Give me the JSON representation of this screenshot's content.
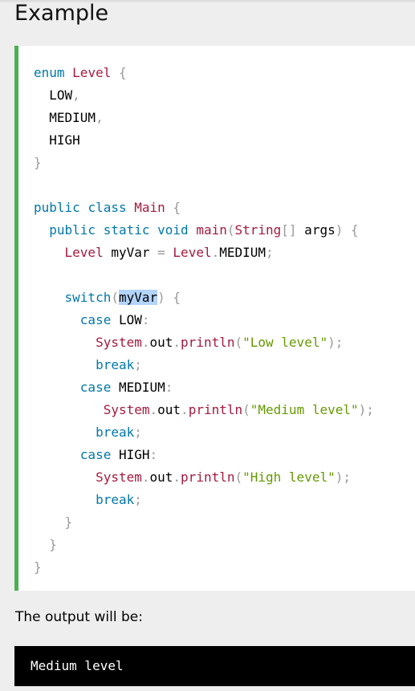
{
  "heading": "Example",
  "code_lines": [
    [
      [
        "kw",
        "enum"
      ],
      [
        "id",
        " "
      ],
      [
        "ty",
        "Level"
      ],
      [
        "id",
        " "
      ],
      [
        "sy",
        "{"
      ]
    ],
    [
      [
        "id",
        "  LOW"
      ],
      [
        "sy",
        ","
      ]
    ],
    [
      [
        "id",
        "  MEDIUM"
      ],
      [
        "sy",
        ","
      ]
    ],
    [
      [
        "id",
        "  HIGH"
      ]
    ],
    [
      [
        "sy",
        "}"
      ]
    ],
    [],
    [
      [
        "kw",
        "public"
      ],
      [
        "id",
        " "
      ],
      [
        "kw",
        "class"
      ],
      [
        "id",
        " "
      ],
      [
        "ty",
        "Main"
      ],
      [
        "id",
        " "
      ],
      [
        "sy",
        "{"
      ]
    ],
    [
      [
        "id",
        "  "
      ],
      [
        "kw",
        "public"
      ],
      [
        "id",
        " "
      ],
      [
        "kw",
        "static"
      ],
      [
        "id",
        " "
      ],
      [
        "kw",
        "void"
      ],
      [
        "id",
        " "
      ],
      [
        "ty",
        "main"
      ],
      [
        "sy",
        "("
      ],
      [
        "ty",
        "String"
      ],
      [
        "sy",
        "[]"
      ],
      [
        "id",
        " args"
      ],
      [
        "sy",
        ")"
      ],
      [
        "id",
        " "
      ],
      [
        "sy",
        "{"
      ]
    ],
    [
      [
        "id",
        "    "
      ],
      [
        "ty",
        "Level"
      ],
      [
        "id",
        " myVar "
      ],
      [
        "sy",
        "="
      ],
      [
        "id",
        " "
      ],
      [
        "ty",
        "Level"
      ],
      [
        "sy",
        "."
      ],
      [
        "id",
        "MEDIUM"
      ],
      [
        "sy",
        ";"
      ]
    ],
    [],
    [
      [
        "id",
        "    "
      ],
      [
        "kw",
        "switch"
      ],
      [
        "sy",
        "("
      ],
      [
        "hl",
        "myVar"
      ],
      [
        "sy",
        ")"
      ],
      [
        "id",
        " "
      ],
      [
        "sy",
        "{"
      ]
    ],
    [
      [
        "id",
        "      "
      ],
      [
        "kw",
        "case"
      ],
      [
        "id",
        " LOW"
      ],
      [
        "sy",
        ":"
      ]
    ],
    [
      [
        "id",
        "        "
      ],
      [
        "ty",
        "System"
      ],
      [
        "sy",
        "."
      ],
      [
        "id",
        "out"
      ],
      [
        "sy",
        "."
      ],
      [
        "ty",
        "println"
      ],
      [
        "sy",
        "("
      ],
      [
        "str",
        "\"Low level\""
      ],
      [
        "sy",
        ");"
      ]
    ],
    [
      [
        "id",
        "        "
      ],
      [
        "kw",
        "break"
      ],
      [
        "sy",
        ";"
      ]
    ],
    [
      [
        "id",
        "      "
      ],
      [
        "kw",
        "case"
      ],
      [
        "id",
        " MEDIUM"
      ],
      [
        "sy",
        ":"
      ]
    ],
    [
      [
        "id",
        "         "
      ],
      [
        "ty",
        "System"
      ],
      [
        "sy",
        "."
      ],
      [
        "id",
        "out"
      ],
      [
        "sy",
        "."
      ],
      [
        "ty",
        "println"
      ],
      [
        "sy",
        "("
      ],
      [
        "str",
        "\"Medium level\""
      ],
      [
        "sy",
        ");"
      ]
    ],
    [
      [
        "id",
        "        "
      ],
      [
        "kw",
        "break"
      ],
      [
        "sy",
        ";"
      ]
    ],
    [
      [
        "id",
        "      "
      ],
      [
        "kw",
        "case"
      ],
      [
        "id",
        " HIGH"
      ],
      [
        "sy",
        ":"
      ]
    ],
    [
      [
        "id",
        "        "
      ],
      [
        "ty",
        "System"
      ],
      [
        "sy",
        "."
      ],
      [
        "id",
        "out"
      ],
      [
        "sy",
        "."
      ],
      [
        "ty",
        "println"
      ],
      [
        "sy",
        "("
      ],
      [
        "str",
        "\"High level\""
      ],
      [
        "sy",
        ");"
      ]
    ],
    [
      [
        "id",
        "        "
      ],
      [
        "kw",
        "break"
      ],
      [
        "sy",
        ";"
      ]
    ],
    [
      [
        "id",
        "    "
      ],
      [
        "sy",
        "}"
      ]
    ],
    [
      [
        "id",
        "  "
      ],
      [
        "sy",
        "}"
      ]
    ],
    [
      [
        "sy",
        "}"
      ]
    ]
  ],
  "output_label": "The output will be:",
  "output_text": "Medium level",
  "colors": {
    "accent_border": "#4caf50",
    "keyword": "#0077aa",
    "type": "#a51a3d",
    "symbol": "#999999",
    "string": "#669900",
    "selection": "#b3d4fc"
  }
}
